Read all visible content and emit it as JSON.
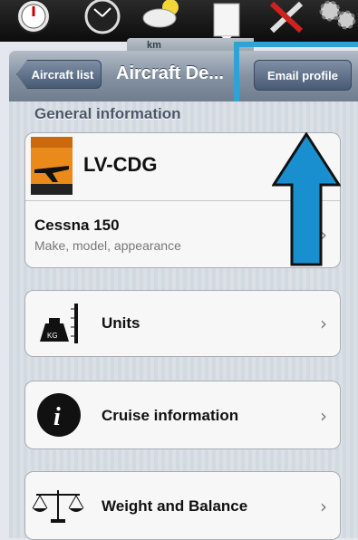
{
  "toolbar": {
    "icons": [
      "speed-gauge-icon",
      "altimeter-gauge-icon",
      "weather-icon",
      "document-icon",
      "tools-icon",
      "settings-gears-icon"
    ],
    "map_scale_label": "km"
  },
  "nav": {
    "back_label": "Aircraft list",
    "title": "Aircraft De...",
    "email_label": "Email profile"
  },
  "general": {
    "header": "General information",
    "registration": "LV-CDG",
    "model": "Cessna 150",
    "model_sub": "Make, model, appearance"
  },
  "rows": {
    "units": "Units",
    "cruise": "Cruise information",
    "weight": "Weight and Balance"
  },
  "colors": {
    "highlight": "#2ea4d6",
    "arrow_fill": "#1a8fd0",
    "navbar": "#7f8da0"
  }
}
